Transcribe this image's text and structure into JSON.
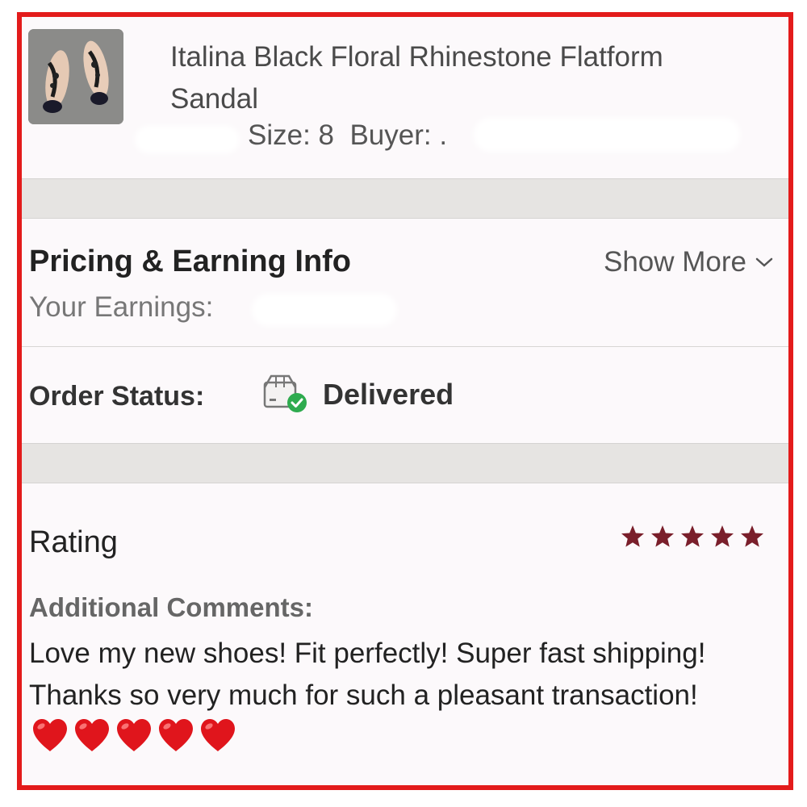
{
  "item": {
    "title": "Italina Black Floral Rhinestone Flatform Sandal",
    "size_label": "Size: 8",
    "buyer_label": "Buyer: ."
  },
  "pricing": {
    "title": "Pricing & Earning Info",
    "show_more": "Show More",
    "earnings_label": "Your Earnings:"
  },
  "order_status": {
    "label": "Order Status:",
    "value": "Delivered",
    "icon": "package-delivered-icon"
  },
  "rating": {
    "title": "Rating",
    "stars": 5,
    "comments_label": "Additional Comments:",
    "comment": "Love my new shoes! Fit perfectly! Super fast shipping! Thanks so very much for such a pleasant transaction!",
    "heart_count": 5
  },
  "colors": {
    "frame": "#e31b1b",
    "star": "#7a1f2b",
    "check": "#2eab4f",
    "heart": "#e0151c"
  }
}
